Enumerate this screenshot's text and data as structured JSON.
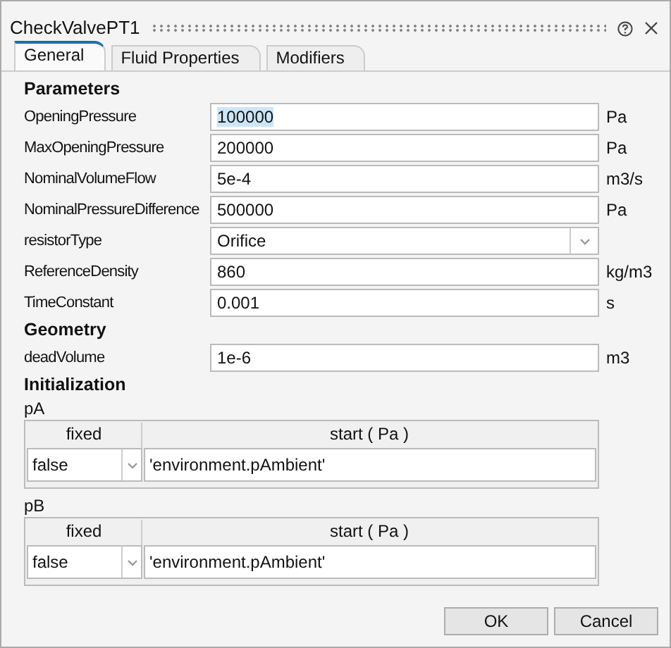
{
  "window": {
    "title": "CheckValvePT1"
  },
  "tabs": [
    {
      "label": "General",
      "selected": true
    },
    {
      "label": "Fluid Properties",
      "selected": false
    },
    {
      "label": "Modifiers",
      "selected": false
    }
  ],
  "sections": [
    {
      "heading": "Parameters",
      "fields": [
        {
          "kind": "text",
          "label": "OpeningPressure",
          "value": "100000",
          "unit": "Pa",
          "text_selected": true
        },
        {
          "kind": "text",
          "label": "MaxOpeningPressure",
          "value": "200000",
          "unit": "Pa"
        },
        {
          "kind": "text",
          "label": "NominalVolumeFlow",
          "value": "5e-4",
          "unit": "m3/s"
        },
        {
          "kind": "text",
          "label": "NominalPressureDifference",
          "value": "500000",
          "unit": "Pa"
        },
        {
          "kind": "dropdown",
          "label": "resistorType",
          "value": "Orifice"
        },
        {
          "kind": "text",
          "label": "ReferenceDensity",
          "value": "860",
          "unit": "kg/m3"
        },
        {
          "kind": "text",
          "label": "TimeConstant",
          "value": "0.001",
          "unit": "s"
        }
      ]
    },
    {
      "heading": "Geometry",
      "fields": [
        {
          "kind": "text",
          "label": "deadVolume",
          "value": "1e-6",
          "unit": "m3"
        }
      ]
    },
    {
      "heading": "Initialization",
      "groups": [
        {
          "name": "pA",
          "columns": [
            "fixed",
            "start ( Pa )"
          ],
          "fixed": "false",
          "start": "'environment.pAmbient'"
        },
        {
          "name": "pB",
          "columns": [
            "fixed",
            "start ( Pa )"
          ],
          "fixed": "false",
          "start": "'environment.pAmbient'"
        }
      ]
    }
  ],
  "buttons": [
    "OK",
    "Cancel"
  ]
}
